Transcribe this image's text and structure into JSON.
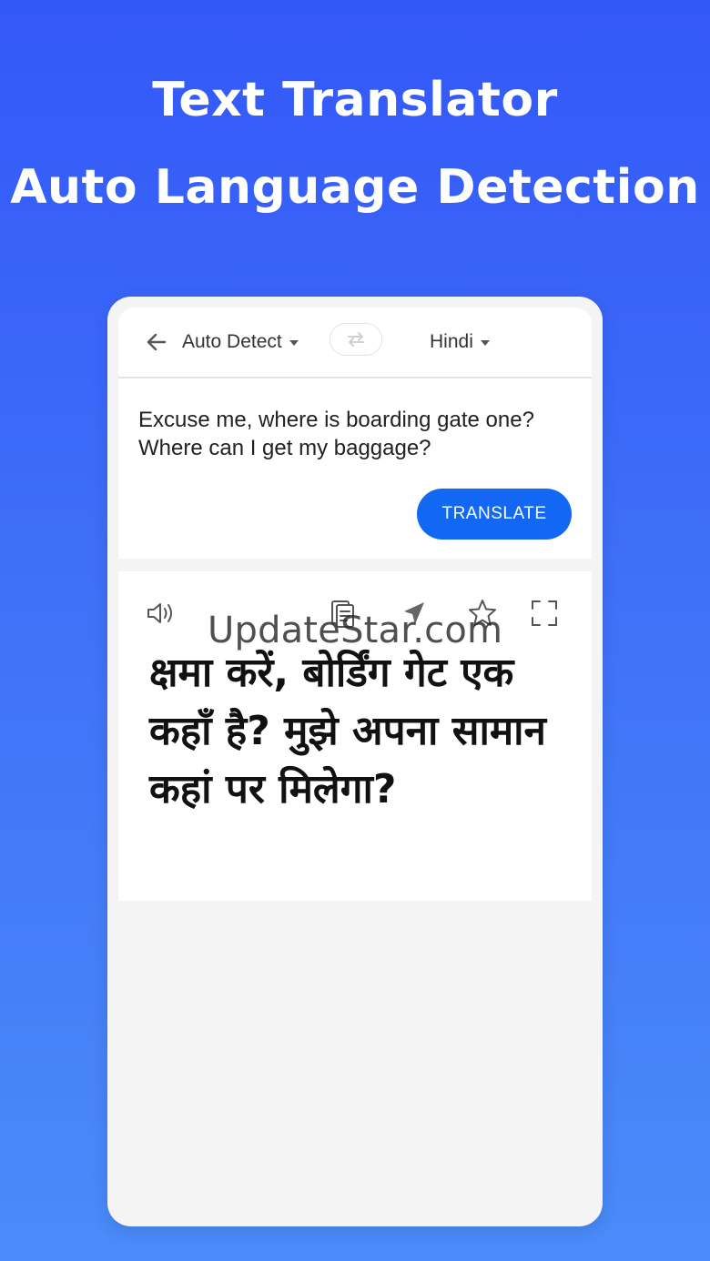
{
  "headline": {
    "line1": "Text Translator",
    "line2": "Auto Language Detection"
  },
  "toolbar": {
    "source_language": "Auto Detect",
    "target_language": "Hindi"
  },
  "input": {
    "text": "Excuse me, where is boarding gate one? Where can I get my baggage?",
    "translate_label": "TRANSLATE"
  },
  "output": {
    "text": "क्षमा करें, बोर्डिंग गेट एक कहाँ है? मुझे अपना सामान कहां पर मिलेगा?",
    "watermark": "UpdateStar.com"
  },
  "colors": {
    "accent": "#1268f3",
    "background_top": "#3358f8",
    "background_bottom": "#4a8bf9"
  },
  "icons": [
    "back-arrow-icon",
    "swap-icon",
    "speaker-icon",
    "copy-icon",
    "send-icon",
    "star-icon",
    "fullscreen-icon"
  ]
}
